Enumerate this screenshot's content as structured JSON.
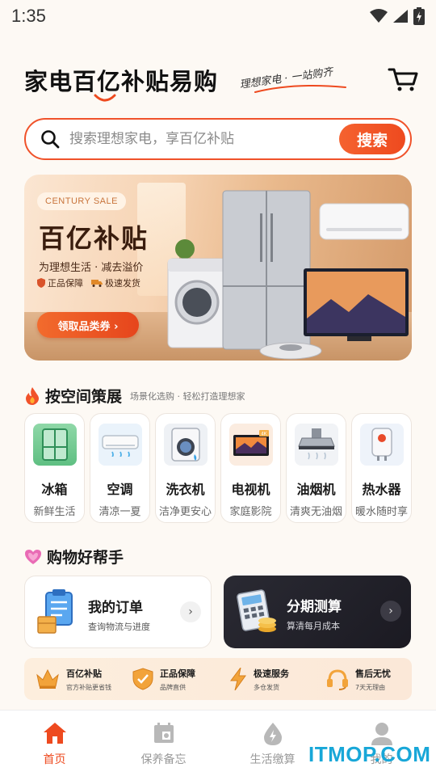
{
  "status_bar": {
    "time": "1:35"
  },
  "header": {
    "title": "家电百亿补贴易购",
    "slogan": "理想家电 · 一站购齐"
  },
  "search": {
    "placeholder": "搜索理想家电，享百亿补贴",
    "button_label": "搜索"
  },
  "banner": {
    "tag": "CENTURY SALE",
    "title": "百亿补贴",
    "subtitle": "为理想生活 · 减去溢价",
    "badges": [
      "正品保障",
      "极速发货"
    ],
    "cta": "领取品类券 ›"
  },
  "category_section": {
    "title": "按空间策展",
    "subtitle": "场景化选购 · 轻松打造理想家",
    "items": [
      {
        "name": "冰箱",
        "desc": "新鲜生活",
        "icon": "refrigerator-icon"
      },
      {
        "name": "空调",
        "desc": "清凉一夏",
        "icon": "air-conditioner-icon"
      },
      {
        "name": "洗衣机",
        "desc": "洁净更安心",
        "icon": "washing-machine-icon"
      },
      {
        "name": "电视机",
        "desc": "家庭影院",
        "icon": "television-icon"
      },
      {
        "name": "油烟机",
        "desc": "清爽无油烟",
        "icon": "range-hood-icon"
      },
      {
        "name": "热水器",
        "desc": "暖水随时享",
        "icon": "water-heater-icon"
      }
    ]
  },
  "helper_section": {
    "title": "购物好帮手",
    "orders": {
      "title": "我的订单",
      "subtitle": "查询物流与进度"
    },
    "installment": {
      "title": "分期测算",
      "subtitle": "算清每月成本"
    }
  },
  "guarantees": [
    {
      "title": "百亿补贴",
      "subtitle": "官方补贴更省钱",
      "icon": "crown-icon"
    },
    {
      "title": "正品保障",
      "subtitle": "品牌直供",
      "icon": "shield-check-icon"
    },
    {
      "title": "极速服务",
      "subtitle": "多仓发货",
      "icon": "lightning-icon"
    },
    {
      "title": "售后无忧",
      "subtitle": "7天无理由",
      "icon": "headset-icon"
    }
  ],
  "tabbar": {
    "tabs": [
      {
        "label": "首页",
        "icon": "home-icon",
        "active": true
      },
      {
        "label": "保养备忘",
        "icon": "notebook-icon",
        "active": false
      },
      {
        "label": "生活缴算",
        "icon": "drop-bolt-icon",
        "active": false
      },
      {
        "label": "我的",
        "icon": "user-icon",
        "active": false
      }
    ]
  },
  "watermark": "ITMOP.COM",
  "colors": {
    "accent": "#ee4a1f",
    "background": "#fdf9f4",
    "dark_card": "#1b1a22"
  }
}
